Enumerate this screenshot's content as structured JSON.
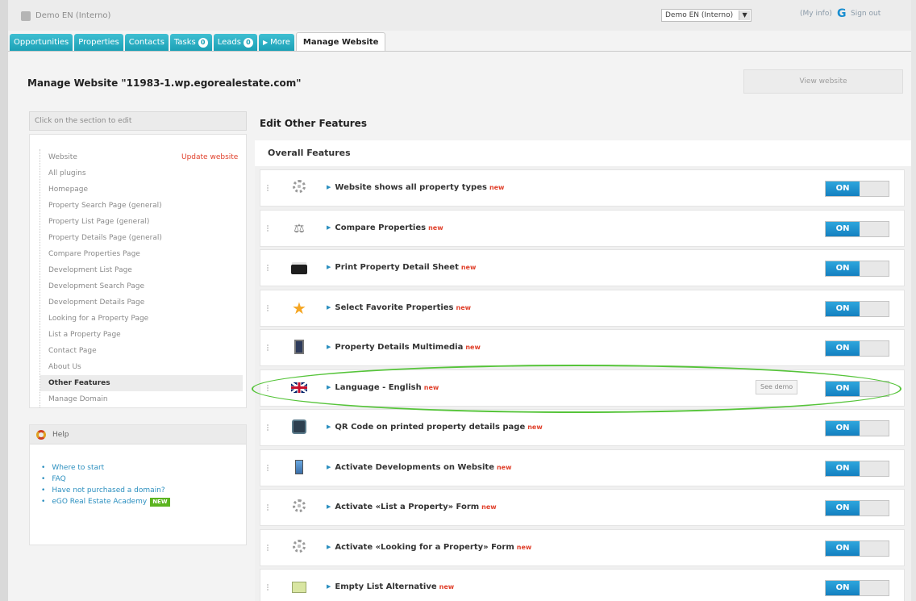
{
  "topbar": {
    "title": "Demo EN (Interno)",
    "account_select": "Demo EN (Interno)",
    "my_info": "(My info)",
    "sign_out": "Sign out"
  },
  "tabs": [
    {
      "label": "Opportunities"
    },
    {
      "label": "Properties"
    },
    {
      "label": "Contacts"
    },
    {
      "label": "Tasks",
      "badge": "0"
    },
    {
      "label": "Leads",
      "badge": "0"
    },
    {
      "label": "More"
    },
    {
      "label": "Manage Website",
      "active": true
    }
  ],
  "page": {
    "title": "Manage Website \"11983-1.wp.egorealestate.com\"",
    "view_website": "View website"
  },
  "sidebar": {
    "header": "Click on the section to edit",
    "update_link": "Update website",
    "items": [
      "Website",
      "All plugins",
      "Homepage",
      "Property Search Page (general)",
      "Property List Page (general)",
      "Property Details Page (general)",
      "Compare Properties Page",
      "Development List Page",
      "Development Search Page",
      "Development Details Page",
      "Looking for a Property Page",
      "List a Property Page",
      "Contact Page",
      "About Us",
      "Other Features",
      "Manage Domain"
    ],
    "current_item": "Other Features"
  },
  "help": {
    "title": "Help",
    "links": [
      "Where to start",
      "FAQ",
      "Have not purchased a domain?",
      "eGO Real Estate Academy"
    ],
    "academy_badge": "NEW"
  },
  "main": {
    "heading": "Edit Other Features",
    "section": "Overall Features",
    "new_label": "new",
    "see_demo": "See demo",
    "toggle_label": "ON",
    "features": [
      {
        "name": "Website shows all property types",
        "icon": "gear-icon",
        "state": "ON"
      },
      {
        "name": "Compare Properties",
        "icon": "compare-icon",
        "state": "ON"
      },
      {
        "name": "Print Property Detail Sheet",
        "icon": "printer-icon",
        "state": "ON"
      },
      {
        "name": "Select Favorite Properties",
        "icon": "star-icon",
        "state": "ON"
      },
      {
        "name": "Property Details Multimedia",
        "icon": "multimedia-icon",
        "state": "ON"
      },
      {
        "name": "Language - English",
        "icon": "uk-flag-icon",
        "state": "ON",
        "see_demo": true
      },
      {
        "name": "QR Code on printed property details page",
        "icon": "qr-code-icon",
        "state": "ON"
      },
      {
        "name": "Activate Developments on Website",
        "icon": "building-icon",
        "state": "ON"
      },
      {
        "name": "Activate «List a Property» Form",
        "icon": "gear-icon",
        "state": "ON"
      },
      {
        "name": "Activate «Looking for a Property» Form",
        "icon": "gear-icon",
        "state": "ON"
      },
      {
        "name": "Empty List Alternative",
        "icon": "list-icon",
        "state": "ON"
      }
    ]
  },
  "colors": {
    "tab": "#1a9fb4",
    "toggle_on": "#1a8ed0",
    "new_tag": "#e0402b",
    "highlight": "#56c43a"
  }
}
